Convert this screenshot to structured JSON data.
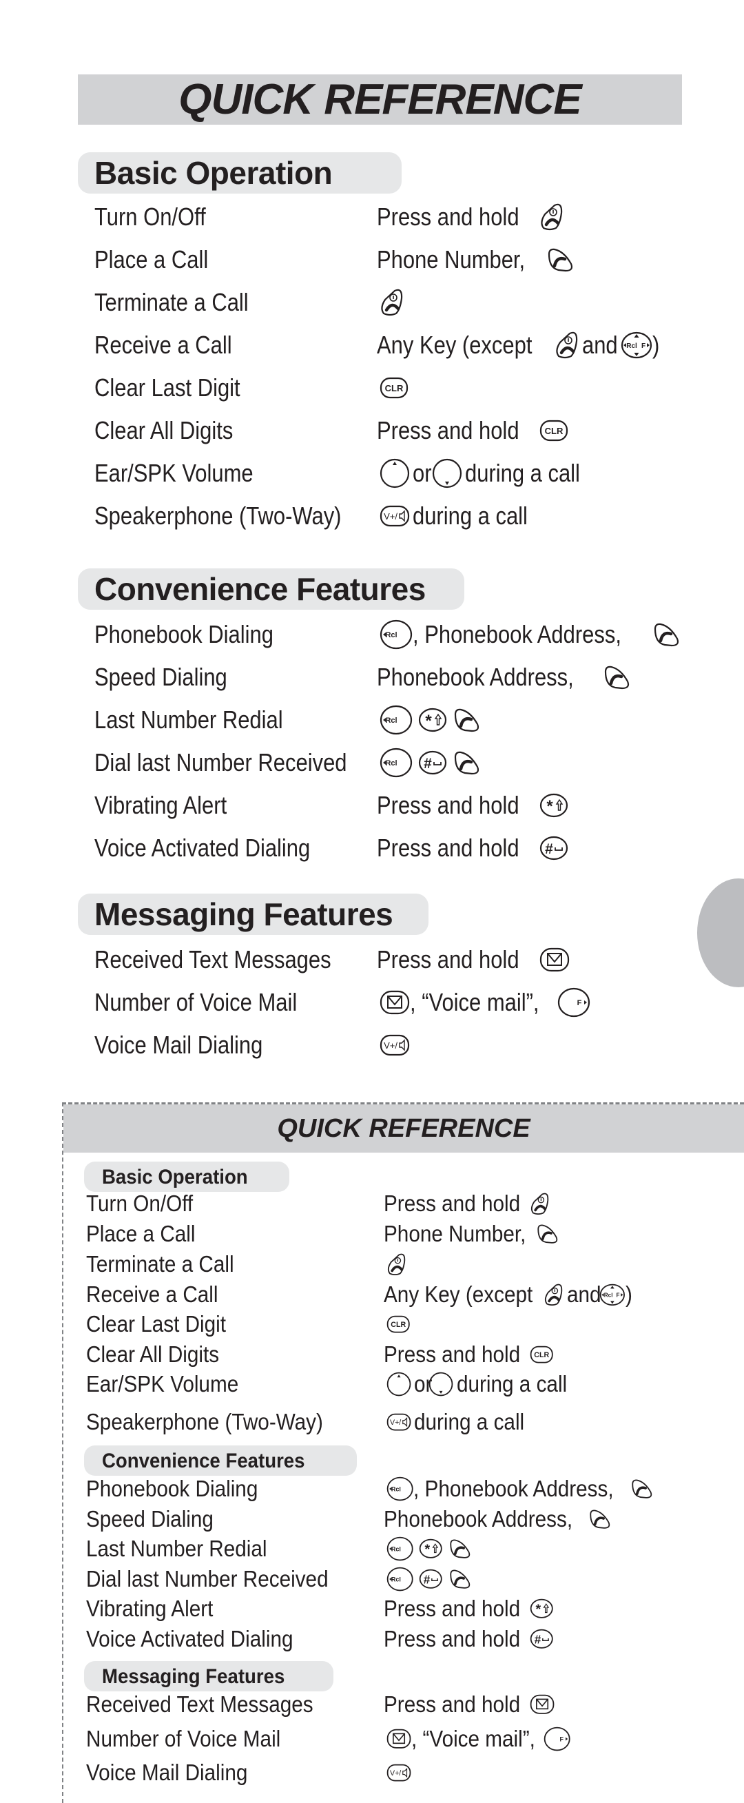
{
  "top_page": {
    "title": "QUICK REFERENCE",
    "sections": [
      {
        "heading": "Basic Operation",
        "rows": [
          {
            "label": "Turn On/Off",
            "action": [
              {
                "text": "Press and hold"
              },
              {
                "key": "end-power-key-icon"
              }
            ]
          },
          {
            "label": "Place a Call",
            "action": [
              {
                "text": "Phone Number,"
              },
              {
                "key": "send-key-icon"
              }
            ]
          },
          {
            "label": "Terminate a Call",
            "action": [
              {
                "key": "end-power-key-icon"
              }
            ]
          },
          {
            "label": "Receive a Call",
            "action": [
              {
                "text": "Any Key (except"
              },
              {
                "key": "end-power-key-icon"
              },
              {
                "text": "and"
              },
              {
                "key": "navigation-key-icon"
              },
              {
                "text": ")"
              }
            ]
          },
          {
            "label": "Clear Last Digit",
            "action": [
              {
                "key": "clr-key-icon"
              }
            ]
          },
          {
            "label": "Clear All Digits",
            "action": [
              {
                "text": "Press and hold"
              },
              {
                "key": "clr-key-icon"
              }
            ]
          },
          {
            "label": "Ear/SPK Volume",
            "action": [
              {
                "key": "volume-up-key-icon"
              },
              {
                "text": "or"
              },
              {
                "key": "volume-down-key-icon"
              },
              {
                "text": "during a call"
              }
            ]
          },
          {
            "label": "Speakerphone (Two-Way)",
            "action": [
              {
                "key": "speaker-key-icon"
              },
              {
                "text": "during a call"
              }
            ]
          }
        ]
      },
      {
        "heading": "Convenience Features",
        "rows": [
          {
            "label": "Phonebook Dialing",
            "action": [
              {
                "key": "rcl-key-icon"
              },
              {
                "text": ", Phonebook Address,"
              },
              {
                "key": "send-key-icon"
              }
            ]
          },
          {
            "label": "Speed Dialing",
            "action": [
              {
                "text": "Phonebook Address,"
              },
              {
                "key": "send-key-icon"
              }
            ]
          },
          {
            "label": "Last Number Redial",
            "action": [
              {
                "key": "rcl-key-icon"
              },
              {
                "key": "star-shift-key-icon"
              },
              {
                "key": "send-key-icon"
              }
            ]
          },
          {
            "label": "Dial last Number Received",
            "action": [
              {
                "key": "rcl-key-icon"
              },
              {
                "key": "pound-space-key-icon"
              },
              {
                "key": "send-key-icon"
              }
            ]
          },
          {
            "label": "Vibrating Alert",
            "action": [
              {
                "text": "Press and hold"
              },
              {
                "key": "star-shift-key-icon"
              }
            ]
          },
          {
            "label": "Voice Activated Dialing",
            "action": [
              {
                "text": "Press and hold"
              },
              {
                "key": "pound-space-key-icon"
              }
            ]
          }
        ]
      },
      {
        "heading": "Messaging Features",
        "rows": [
          {
            "label": "Received Text Messages",
            "action": [
              {
                "text": "Press and hold"
              },
              {
                "key": "message-key-icon"
              }
            ]
          },
          {
            "label": "Number of Voice Mail",
            "action": [
              {
                "key": "message-key-icon"
              },
              {
                "text": ", “Voice mail”,"
              },
              {
                "key": "f-key-icon"
              }
            ]
          },
          {
            "label": "Voice Mail Dialing",
            "action": [
              {
                "key": "speaker-key-icon"
              }
            ]
          }
        ]
      }
    ]
  },
  "bottom_page": {
    "title": "QUICK REFERENCE",
    "sections": [
      {
        "heading": "Basic Operation",
        "rows": [
          {
            "label": "Turn On/Off",
            "action": [
              {
                "text": "Press and hold"
              },
              {
                "key": "end-power-key-icon"
              }
            ]
          },
          {
            "label": "Place a Call",
            "action": [
              {
                "text": "Phone Number,"
              },
              {
                "key": "send-key-icon"
              }
            ]
          },
          {
            "label": "Terminate a Call",
            "action": [
              {
                "key": "end-power-key-icon"
              }
            ]
          },
          {
            "label": "Receive a Call",
            "action": [
              {
                "text": "Any Key (except"
              },
              {
                "key": "end-power-key-icon"
              },
              {
                "text": "and"
              },
              {
                "key": "navigation-key-icon"
              },
              {
                "text": ")"
              }
            ]
          },
          {
            "label": "Clear Last Digit",
            "action": [
              {
                "key": "clr-key-icon"
              }
            ]
          },
          {
            "label": "Clear All Digits",
            "action": [
              {
                "text": "Press and hold"
              },
              {
                "key": "clr-key-icon"
              }
            ]
          },
          {
            "label": "Ear/SPK Volume",
            "action": [
              {
                "key": "volume-up-key-icon"
              },
              {
                "text": "or"
              },
              {
                "key": "volume-down-key-icon"
              },
              {
                "text": "during a call"
              }
            ]
          },
          {
            "label": "Speakerphone (Two-Way)",
            "action": [
              {
                "key": "speaker-key-icon"
              },
              {
                "text": "during a call"
              }
            ]
          }
        ]
      },
      {
        "heading": "Convenience Features",
        "rows": [
          {
            "label": "Phonebook Dialing",
            "action": [
              {
                "key": "rcl-key-icon"
              },
              {
                "text": ", Phonebook Address,"
              },
              {
                "key": "send-key-icon"
              }
            ]
          },
          {
            "label": "Speed Dialing",
            "action": [
              {
                "text": "Phonebook Address,"
              },
              {
                "key": "send-key-icon"
              }
            ]
          },
          {
            "label": "Last Number Redial",
            "action": [
              {
                "key": "rcl-key-icon"
              },
              {
                "key": "star-shift-key-icon"
              },
              {
                "key": "send-key-icon"
              }
            ]
          },
          {
            "label": "Dial last Number Received",
            "action": [
              {
                "key": "rcl-key-icon"
              },
              {
                "key": "pound-space-key-icon"
              },
              {
                "key": "send-key-icon"
              }
            ]
          },
          {
            "label": "Vibrating Alert",
            "action": [
              {
                "text": "Press and hold"
              },
              {
                "key": "star-shift-key-icon"
              }
            ]
          },
          {
            "label": "Voice Activated Dialing",
            "action": [
              {
                "text": "Press and hold"
              },
              {
                "key": "pound-space-key-icon"
              }
            ]
          }
        ]
      },
      {
        "heading": "Messaging Features",
        "rows": [
          {
            "label": "Received Text Messages",
            "action": [
              {
                "text": "Press and hold"
              },
              {
                "key": "message-key-icon"
              }
            ]
          },
          {
            "label": "Number of Voice Mail",
            "action": [
              {
                "key": "message-key-icon"
              },
              {
                "text": ", “Voice mail”,"
              },
              {
                "key": "f-key-icon"
              }
            ]
          },
          {
            "label": "Voice Mail Dialing",
            "action": [
              {
                "key": "speaker-key-icon"
              }
            ]
          }
        ]
      }
    ]
  },
  "key_labels": {
    "clr": "CLR",
    "rcl": "Rcl",
    "f": "F",
    "speaker": "V+/"
  },
  "colors": {
    "title_band": "#d1d2d4",
    "section_pill": "#e6e7e8",
    "side_tab": "#bcbdc0",
    "text": "#231f20",
    "cut_line": "#808285"
  }
}
